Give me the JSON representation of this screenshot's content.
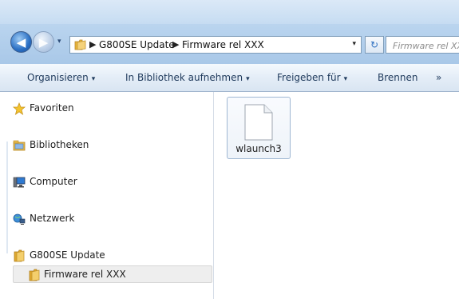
{
  "address": {
    "crumbs": [
      "G800SE Update",
      "Firmware rel XXX"
    ],
    "separator": "▶",
    "dropdown": "▾"
  },
  "search": {
    "placeholder": "Firmware rel XXX durchsuchen"
  },
  "nav": {
    "refresh_glyph": "↻"
  },
  "toolbar": {
    "items": [
      {
        "label": "Organisieren",
        "caret": "▾"
      },
      {
        "label": "In Bibliothek aufnehmen",
        "caret": "▾"
      },
      {
        "label": "Freigeben für",
        "caret": "▾"
      },
      {
        "label": "Brennen"
      },
      {
        "label": "»"
      }
    ]
  },
  "sidebar": {
    "items": [
      {
        "label": "Favoriten",
        "icon": "star-icon"
      },
      {
        "label": "Bibliotheken",
        "icon": "libraries-icon"
      },
      {
        "label": "Computer",
        "icon": "computer-icon"
      },
      {
        "label": "Netzwerk",
        "icon": "network-icon"
      },
      {
        "label": "G800SE Update",
        "icon": "folder-icon"
      },
      {
        "label": "Firmware rel XXX",
        "icon": "folder-icon",
        "selected": true
      }
    ]
  },
  "files": [
    {
      "name": "wlaunch3",
      "icon": "generic-file-icon"
    }
  ],
  "colors": {
    "accent": "#2a6fc4",
    "command_text": "#1e395b"
  }
}
